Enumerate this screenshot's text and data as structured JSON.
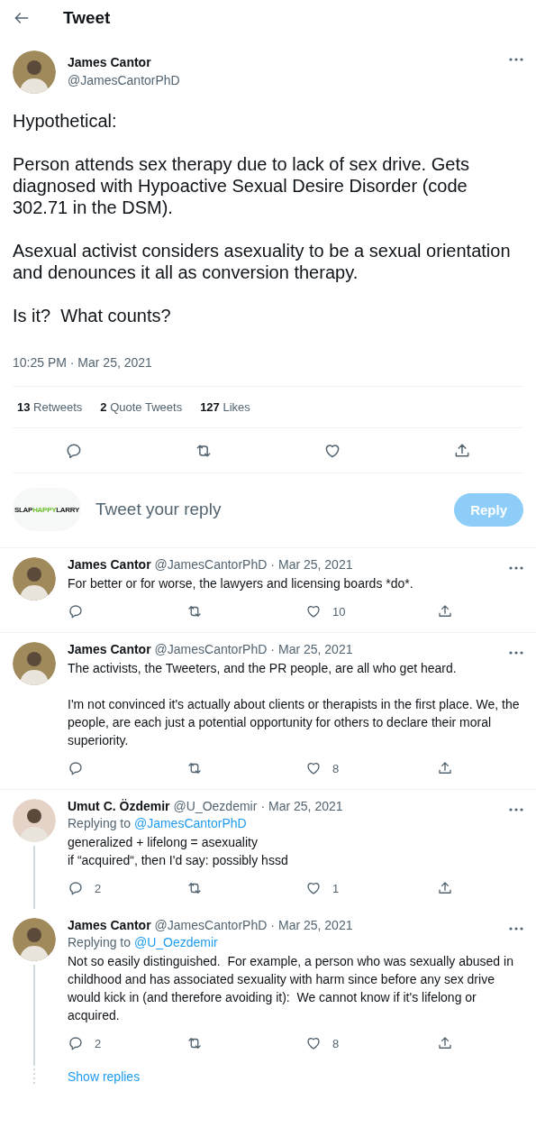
{
  "header": {
    "title": "Tweet"
  },
  "tweet": {
    "author": {
      "name": "James Cantor",
      "handle": "@JamesCantorPhD"
    },
    "paragraphs": [
      "Hypothetical:",
      "Person attends sex therapy due to lack of sex drive. Gets diagnosed with Hypoactive Sexual Desire Disorder (code 302.71 in the DSM).",
      "Asexual activist considers asexuality to be a sexual orientation and denounces it all as conversion therapy.",
      "Is it?  What counts?"
    ],
    "timestamp": "10:25 PM · Mar 25, 2021",
    "stats": [
      {
        "count": "13",
        "label": "Retweets"
      },
      {
        "count": "2",
        "label": "Quote Tweets"
      },
      {
        "count": "127",
        "label": "Likes"
      }
    ]
  },
  "reply_box": {
    "logo": [
      "SLAP",
      "HAPPY",
      "LARRY"
    ],
    "placeholder": "Tweet your reply",
    "button": {
      "label": "Reply",
      "disabled": true
    }
  },
  "replies": [
    {
      "name": "James Cantor",
      "handle": "@JamesCantorPhD",
      "separator": "·",
      "date": "Mar 25, 2021",
      "paragraphs": [
        "For better or for worse, the lawyers and licensing boards *do*."
      ],
      "likes": "10",
      "connected_below": false
    },
    {
      "name": "James Cantor",
      "handle": "@JamesCantorPhD",
      "separator": "·",
      "date": "Mar 25, 2021",
      "paragraphs": [
        "The activists, the Tweeters, and the PR people, are all who get heard.",
        "I'm not convinced it's actually about clients or therapists in the first place. We, the people, are each just a potential opportunity for others to declare their moral superiority."
      ],
      "likes": "8",
      "connected_below": false
    },
    {
      "name": "Umut C. Özdemir",
      "handle": "@U_Oezdemir",
      "separator": "·",
      "date": "Mar 25, 2021",
      "replying_label": "Replying to",
      "replying_to": "@JamesCantorPhD",
      "paragraphs": [
        "generalized + lifelong = asexuality\nif “acquired“, then I'd say: possibly hssd"
      ],
      "replies": "2",
      "likes": "1",
      "connected_below": true
    },
    {
      "name": "James Cantor",
      "handle": "@JamesCantorPhD",
      "separator": "·",
      "date": "Mar 25, 2021",
      "replying_label": "Replying to",
      "replying_to": "@U_Oezdemir",
      "paragraphs": [
        "Not so easily distinguished.  For example, a person who was sexually abused in childhood and has associated sexuality with harm since before any sex drive would kick in (and therefore avoiding it):  We cannot know if it's lifelong or acquired."
      ],
      "replies": "2",
      "likes": "8",
      "connected_below": true
    }
  ],
  "show_replies": "Show replies"
}
